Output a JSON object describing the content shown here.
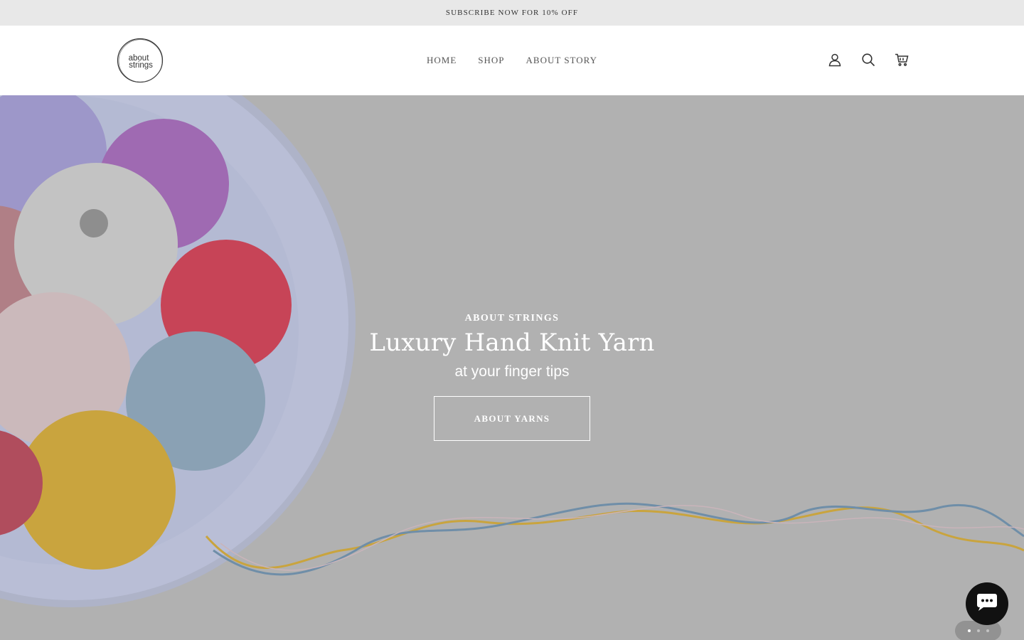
{
  "announcement": {
    "text": "SUBSCRIBE NOW FOR 10% OFF"
  },
  "header": {
    "logo_text": "about strings",
    "nav": [
      {
        "label": "HOME"
      },
      {
        "label": "SHOP"
      },
      {
        "label": "ABOUT STORY"
      }
    ],
    "icons": [
      "account-icon",
      "search-icon",
      "cart-icon"
    ]
  },
  "hero": {
    "eyebrow": "ABOUT STRINGS",
    "headline": "Luxury Hand Knit Yarn",
    "subheadline": "at your finger tips",
    "cta_label": "ABOUT YARNS",
    "slides": {
      "count": 3,
      "active": 1
    }
  },
  "chat": {
    "icon": "chat-icon"
  },
  "colors": {
    "announcement_bg": "#e8e8e8",
    "hero_bg": "#b1b1b1",
    "chat_bg": "#111111"
  }
}
